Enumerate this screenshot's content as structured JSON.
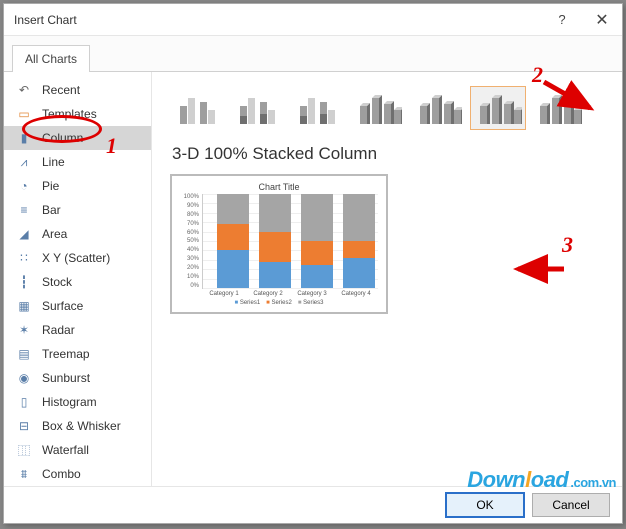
{
  "window": {
    "title": "Insert Chart",
    "help_symbol": "?",
    "close_symbol": "✕"
  },
  "tabs": {
    "all": "All Charts"
  },
  "sidebar": {
    "items": [
      {
        "name": "recent",
        "label": "Recent",
        "icon": "↶"
      },
      {
        "name": "templates",
        "label": "Templates",
        "icon": "▭"
      },
      {
        "name": "column",
        "label": "Column",
        "icon": "▮",
        "selected": true
      },
      {
        "name": "line",
        "label": "Line",
        "icon": "⩘"
      },
      {
        "name": "pie",
        "label": "Pie",
        "icon": "◔"
      },
      {
        "name": "bar",
        "label": "Bar",
        "icon": "≡"
      },
      {
        "name": "area",
        "label": "Area",
        "icon": "◢"
      },
      {
        "name": "scatter",
        "label": "X Y (Scatter)",
        "icon": "∷"
      },
      {
        "name": "stock",
        "label": "Stock",
        "icon": "┇"
      },
      {
        "name": "surface",
        "label": "Surface",
        "icon": "▦"
      },
      {
        "name": "radar",
        "label": "Radar",
        "icon": "✶"
      },
      {
        "name": "treemap",
        "label": "Treemap",
        "icon": "▤"
      },
      {
        "name": "sunburst",
        "label": "Sunburst",
        "icon": "◉"
      },
      {
        "name": "histogram",
        "label": "Histogram",
        "icon": "▯"
      },
      {
        "name": "boxwhisker",
        "label": "Box & Whisker",
        "icon": "⊟"
      },
      {
        "name": "waterfall",
        "label": "Waterfall",
        "icon": "⿲"
      },
      {
        "name": "combo",
        "label": "Combo",
        "icon": "⩩"
      }
    ]
  },
  "subtypes": {
    "selected_index": 5,
    "count": 7,
    "selected_label": "3-D 100% Stacked Column"
  },
  "preview": {
    "title": "Chart Title",
    "ylabels": [
      "100%",
      "90%",
      "80%",
      "70%",
      "60%",
      "50%",
      "40%",
      "30%",
      "20%",
      "10%",
      "0%"
    ],
    "categories": [
      "Category 1",
      "Category 2",
      "Category 3",
      "Category 4"
    ],
    "legend": [
      "Series1",
      "Series2",
      "Series3"
    ]
  },
  "chart_data": {
    "type": "bar",
    "stacked": "100%",
    "threeD": true,
    "title": "Chart Title",
    "xlabel": "",
    "ylabel": "",
    "ylim": [
      0,
      100
    ],
    "categories": [
      "Category 1",
      "Category 2",
      "Category 3",
      "Category 4"
    ],
    "series": [
      {
        "name": "Series1",
        "color": "#5b9bd5",
        "values": [
          40,
          28,
          25,
          32
        ]
      },
      {
        "name": "Series2",
        "color": "#ed7d31",
        "values": [
          28,
          32,
          25,
          18
        ]
      },
      {
        "name": "Series3",
        "color": "#a5a5a5",
        "values": [
          32,
          40,
          50,
          50
        ]
      }
    ]
  },
  "footer": {
    "ok": "OK",
    "cancel": "Cancel"
  },
  "annotations": {
    "n1": "1",
    "n2": "2",
    "n3": "3"
  },
  "watermark": {
    "part1": "D",
    "part2": "own",
    "part3": "l",
    "part4": "oad",
    "tail": ".com.vn"
  }
}
